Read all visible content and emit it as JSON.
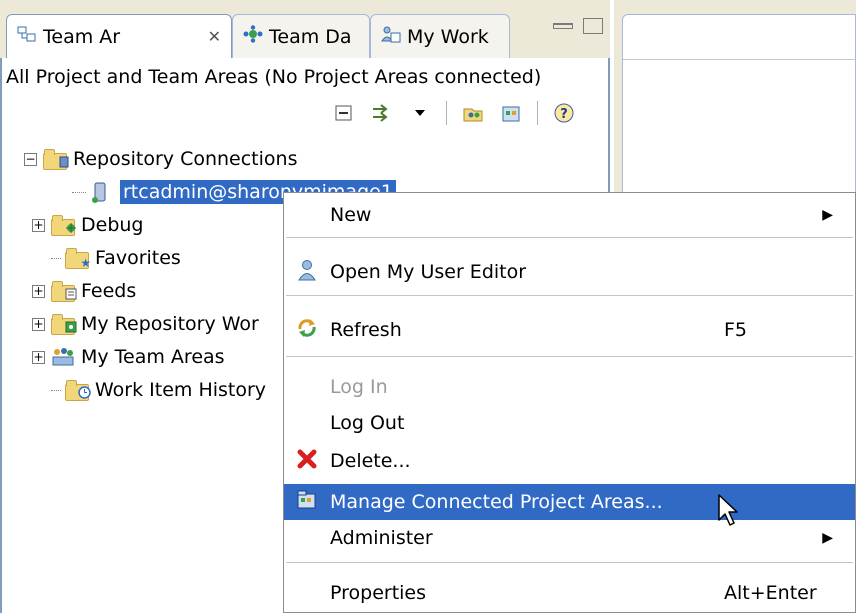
{
  "tabs": [
    {
      "label": "Team Ar",
      "close": "✕",
      "icon": "team-artifacts-icon"
    },
    {
      "label": "Team Da",
      "icon": "team-dashboard-icon"
    },
    {
      "label": "My Work",
      "icon": "my-work-icon"
    }
  ],
  "view": {
    "description": "All Project and Team Areas (No Project Areas connected)"
  },
  "tree": [
    {
      "label": "Repository Connections",
      "expander": "−",
      "icon": "repository-connections-icon"
    },
    {
      "label": "rtcadmin@sharonvmimage1",
      "icon": "repository-connection-icon",
      "selected": true
    },
    {
      "label": "Debug",
      "expander": "+",
      "icon": "debug-folder-icon"
    },
    {
      "label": "Favorites",
      "icon": "favorites-folder-icon"
    },
    {
      "label": "Feeds",
      "expander": "+",
      "icon": "feeds-folder-icon"
    },
    {
      "label": "My Repository Wor",
      "expander": "+",
      "icon": "my-repository-workspaces-icon"
    },
    {
      "label": "My Team Areas",
      "expander": "+",
      "icon": "my-team-areas-icon"
    },
    {
      "label": "Work Item History",
      "icon": "work-item-history-icon"
    }
  ],
  "menu": {
    "items": [
      {
        "label": "New",
        "submenu": true
      },
      {
        "label": "Open My User Editor",
        "icon": "user-icon"
      },
      {
        "label": "Refresh",
        "shortcut": "F5",
        "icon": "refresh-icon"
      },
      {
        "label": "Log In",
        "disabled": true
      },
      {
        "label": "Log Out"
      },
      {
        "label": "Delete...",
        "icon": "delete-icon"
      },
      {
        "label": "Manage Connected Project Areas...",
        "icon": "manage-project-areas-icon",
        "highlighted": true
      },
      {
        "label": "Administer",
        "submenu": true
      },
      {
        "label": "Properties",
        "shortcut": "Alt+Enter"
      }
    ]
  },
  "colors": {
    "selection": "#316ac5",
    "chrome": "#ece9d8",
    "border": "#7f9db9"
  }
}
